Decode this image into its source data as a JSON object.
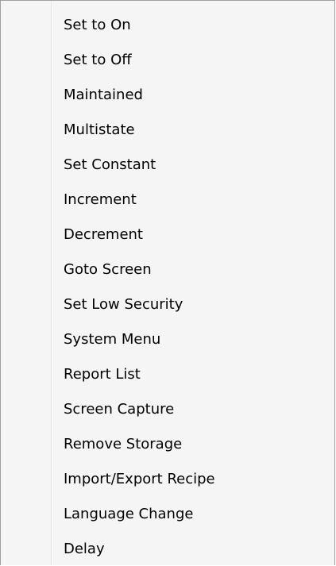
{
  "menu": {
    "items": [
      {
        "label": "Set to On"
      },
      {
        "label": "Set to Off"
      },
      {
        "label": "Maintained"
      },
      {
        "label": "Multistate"
      },
      {
        "label": "Set Constant"
      },
      {
        "label": "Increment"
      },
      {
        "label": "Decrement"
      },
      {
        "label": "Goto Screen"
      },
      {
        "label": "Set Low Security"
      },
      {
        "label": "System Menu"
      },
      {
        "label": "Report List"
      },
      {
        "label": "Screen Capture"
      },
      {
        "label": "Remove Storage"
      },
      {
        "label": "Import/Export Recipe"
      },
      {
        "label": "Language Change"
      },
      {
        "label": "Delay"
      }
    ]
  }
}
